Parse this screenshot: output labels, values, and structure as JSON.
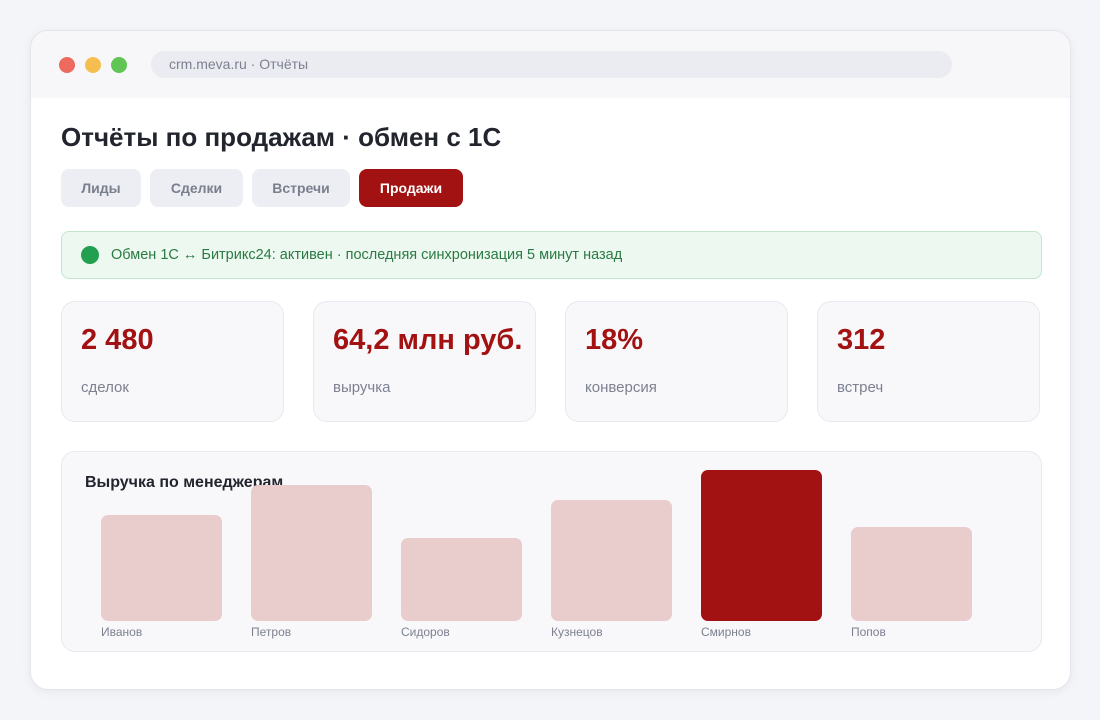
{
  "browser": {
    "url": "crm.meva.ru · Отчёты"
  },
  "page": {
    "title": "Отчёты по продажам · обмен с 1С"
  },
  "tabs": [
    {
      "label": "Лиды",
      "active": false
    },
    {
      "label": "Сделки",
      "active": false
    },
    {
      "label": "Встречи",
      "active": false
    },
    {
      "label": "Продажи",
      "active": true
    }
  ],
  "sync_status": {
    "text": "Обмен 1С ↔ Битрикс24: активен · последняя синхронизация 5 минут назад"
  },
  "kpis": [
    {
      "value": "2 480",
      "label": "сделок"
    },
    {
      "value": "64,2 млн руб.",
      "label": "выручка"
    },
    {
      "value": "18%",
      "label": "конверсия"
    },
    {
      "value": "312",
      "label": "встреч"
    }
  ],
  "chart": {
    "title": "Выручка по менеджерам",
    "highlight": "Смирнов"
  },
  "chart_data": {
    "type": "bar",
    "title": "Выручка по менеджерам",
    "categories": [
      "Иванов",
      "Петров",
      "Сидоров",
      "Кузнецов",
      "Смирнов",
      "Попов"
    ],
    "values": [
      70,
      90,
      55,
      80,
      100,
      62
    ],
    "ylim": [
      0,
      100
    ],
    "grid": false,
    "legend": "none",
    "highlight_category": "Смирнов"
  },
  "colors": {
    "accent": "#a31212",
    "bar_muted": "#e9cdcd",
    "status_green": "#23a04f",
    "dot_red": "#ed6a5e",
    "dot_yellow": "#f5bf4f",
    "dot_green": "#61c554"
  }
}
